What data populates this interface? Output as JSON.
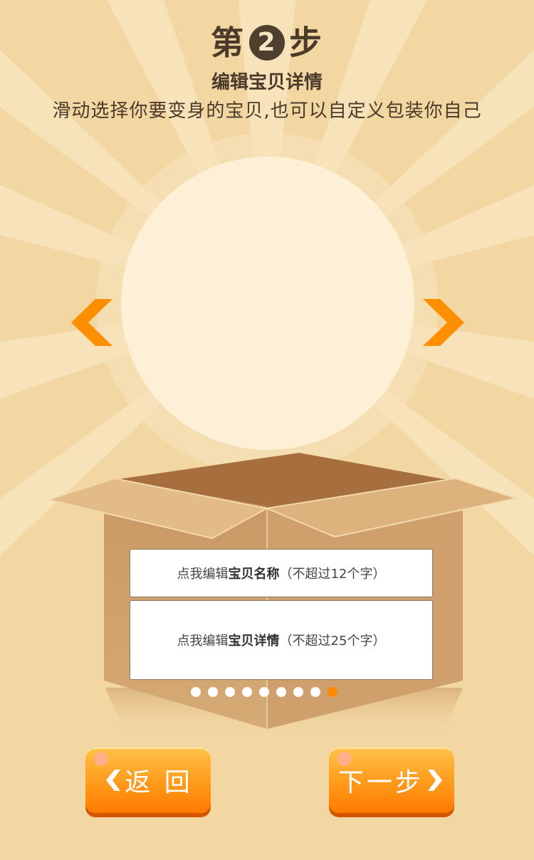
{
  "header": {
    "step_prefix": "第",
    "step_number": "2",
    "step_suffix": "步",
    "subtitle": "编辑宝贝详情",
    "description": "滑动选择你要变身的宝贝,也可以自定义包装你自己"
  },
  "carousel": {
    "prev_icon": "chevron-left-icon",
    "next_icon": "chevron-right-icon",
    "page_count": 9,
    "active_index": 8
  },
  "fields": {
    "name": {
      "prefix": "点我编辑",
      "bold": "宝贝名称",
      "suffix": "（不超过12个字）"
    },
    "detail": {
      "prefix": "点我编辑",
      "bold": "宝贝详情",
      "suffix": "（不超过25个字）"
    }
  },
  "buttons": {
    "back_label": "返 回",
    "next_label": "下一步"
  },
  "colors": {
    "background": "#f2d7a3",
    "accent": "#ff8a00",
    "text": "#4a3a2a"
  }
}
